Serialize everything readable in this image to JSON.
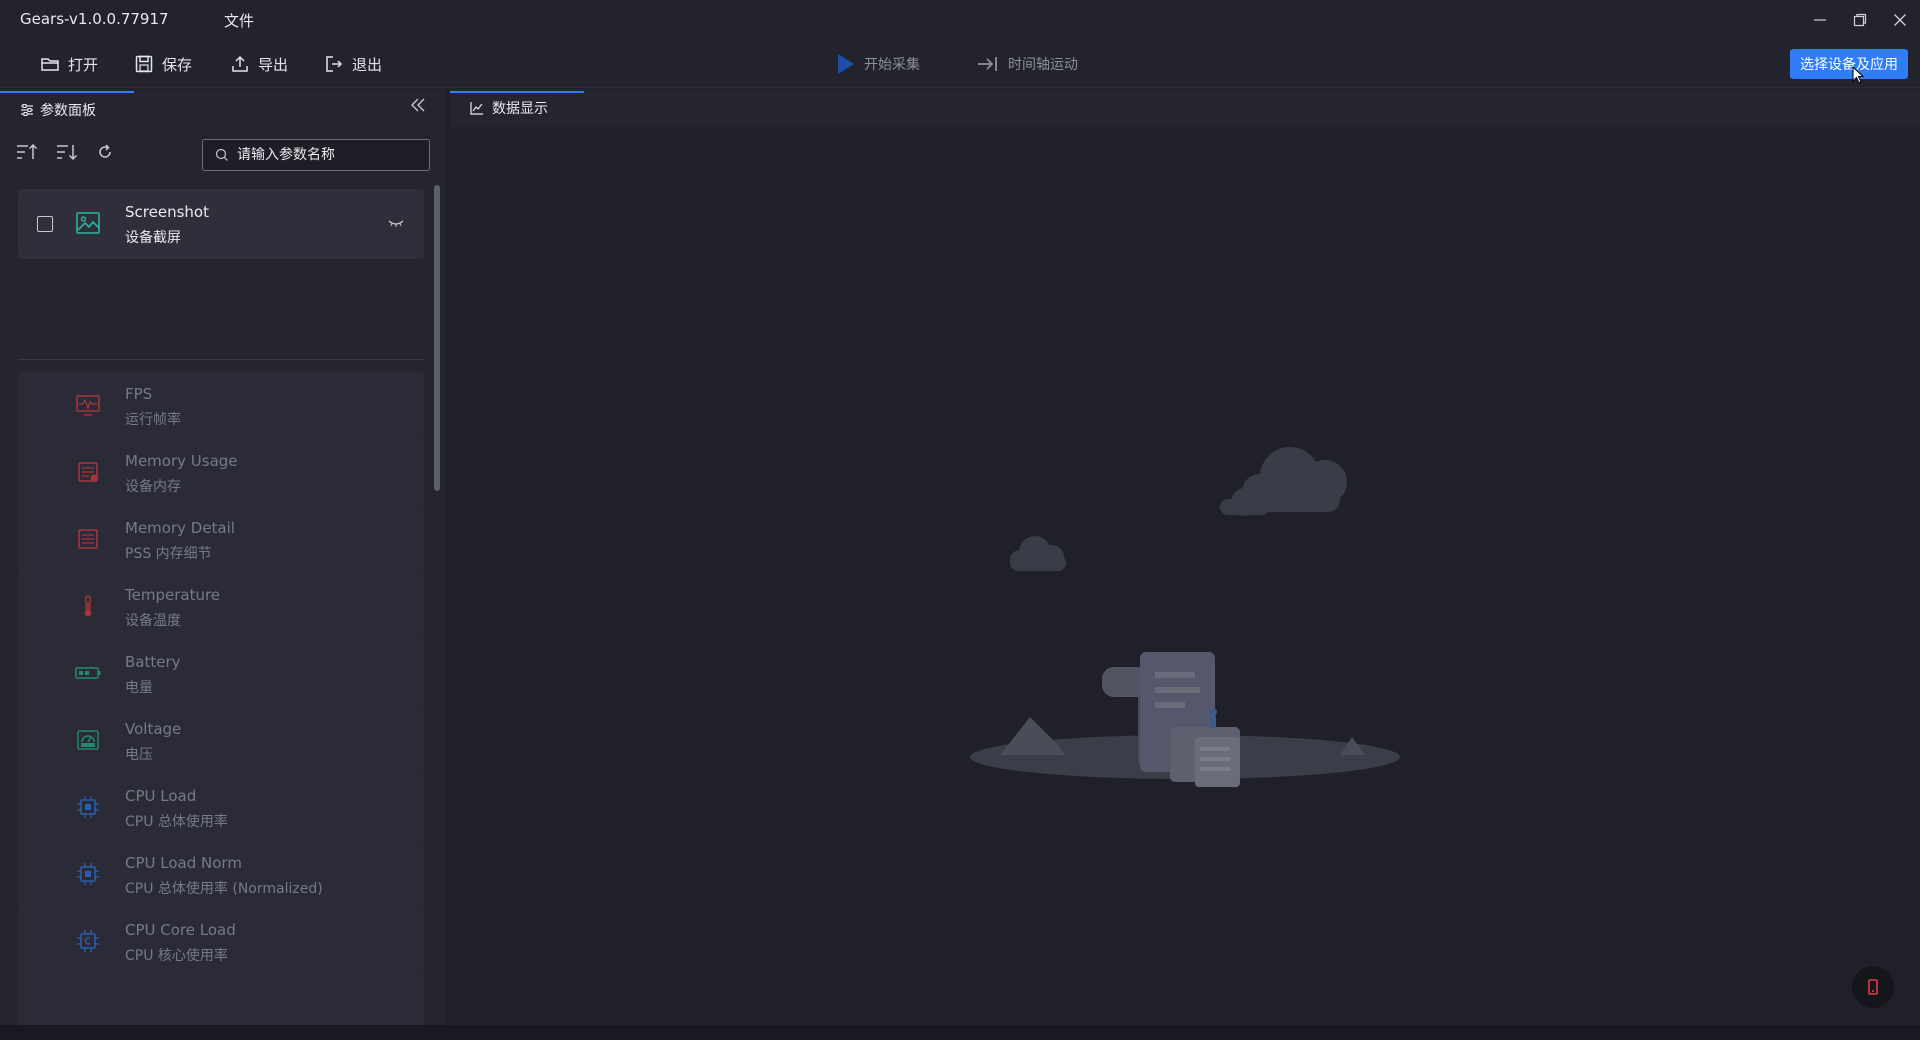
{
  "window": {
    "title": "Gears-v1.0.0.77917",
    "file_menu": "文件"
  },
  "toolbar": {
    "open_label": "打开",
    "save_label": "保存",
    "export_label": "导出",
    "exit_label": "退出",
    "start_capture_label": "开始采集",
    "timeline_label": "时间轴运动",
    "select_device_label": "选择设备及应用"
  },
  "left_panel": {
    "tab_label": "参数面板",
    "search_placeholder": "请输入参数名称",
    "items": [
      {
        "title": "Screenshot",
        "subtitle": "设备截屏",
        "icon": "image-icon",
        "active": true
      },
      {
        "title": "FPS",
        "subtitle": "运行帧率",
        "icon": "monitor-pulse-icon"
      },
      {
        "title": "Memory Usage",
        "subtitle": "设备内存",
        "icon": "memory-usage-icon"
      },
      {
        "title": "Memory Detail",
        "subtitle": "PSS 内存细节",
        "icon": "memory-detail-icon"
      },
      {
        "title": "Temperature",
        "subtitle": "设备温度",
        "icon": "thermometer-icon"
      },
      {
        "title": "Battery",
        "subtitle": "电量",
        "icon": "battery-icon"
      },
      {
        "title": "Voltage",
        "subtitle": "电压",
        "icon": "voltage-icon"
      },
      {
        "title": "CPU Load",
        "subtitle": "CPU 总体使用率",
        "icon": "cpu-icon"
      },
      {
        "title": "CPU Load Norm",
        "subtitle": "CPU 总体使用率 (Normalized)",
        "icon": "cpu-icon"
      },
      {
        "title": "CPU Core Load",
        "subtitle": "CPU 核心使用率",
        "icon": "cpu-core-icon"
      }
    ]
  },
  "right_panel": {
    "tab_label": "数据显示"
  },
  "colors": {
    "accent": "#2f7df6",
    "background": "#1f2029",
    "panel": "#24252f",
    "card": "#2a2b36"
  }
}
